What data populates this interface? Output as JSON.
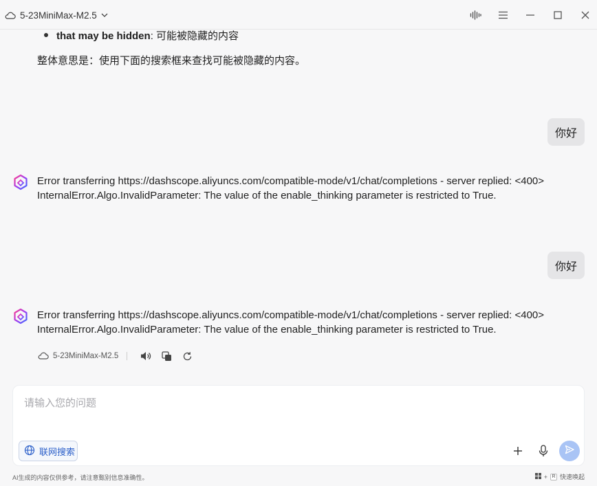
{
  "titlebar": {
    "model_name": "5-23MiniMax-M2.5"
  },
  "conversation": {
    "bullet_bold": "that may be hidden",
    "bullet_rest": ": 可能被隐藏的内容",
    "summary": "整体意思是：使用下面的搜索框来查找可能被隐藏的内容。",
    "user_message_1": "你好",
    "ai_error_1_line1": "Error transferring https://dashscope.aliyuncs.com/compatible-mode/v1/chat/completions - server replied: <400>",
    "ai_error_1_line2": "InternalError.Algo.InvalidParameter: The value of the enable_thinking parameter is restricted to True.",
    "user_message_2": "你好",
    "ai_error_2_line1": "Error transferring https://dashscope.aliyuncs.com/compatible-mode/v1/chat/completions - server replied: <400>",
    "ai_error_2_line2": "InternalError.Algo.InvalidParameter: The value of the enable_thinking parameter is restricted to True.",
    "action_model": "5-23MiniMax-M2.5"
  },
  "input": {
    "placeholder": "请输入您的问题",
    "web_search_label": "联网搜索"
  },
  "footer": {
    "disclaimer": "AI生成的内容仅供参考，请注意甄别信息准确性。",
    "shortcut_plus": "+",
    "shortcut_key": "R",
    "shortcut_label": "快速唤起"
  },
  "colors": {
    "accent": "#2b5fc9",
    "send_button": "#a9c4f5",
    "user_bubble": "#e5e5e7",
    "background": "#f7f7f8"
  },
  "icons": [
    "cloud-icon",
    "chevron-down-icon",
    "voice-wave-icon",
    "menu-icon",
    "minimize-icon",
    "maximize-icon",
    "close-icon",
    "ai-logo-icon",
    "speaker-icon",
    "copy-icon",
    "refresh-icon",
    "globe-icon",
    "plus-icon",
    "microphone-icon",
    "send-icon",
    "windows-key-icon"
  ]
}
